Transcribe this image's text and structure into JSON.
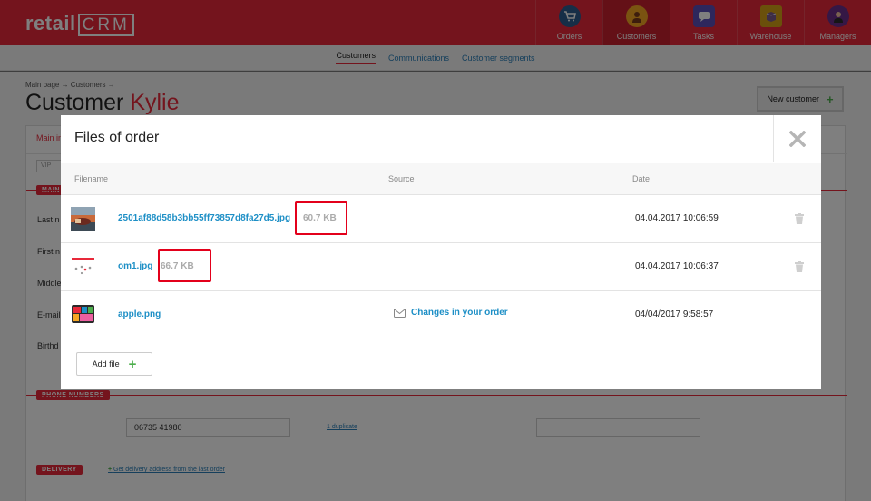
{
  "app": {
    "logo_main": "retail",
    "logo_crm": "CRM"
  },
  "nav": [
    {
      "label": "Orders",
      "icon": "cart-icon",
      "color": "#3a6ea5"
    },
    {
      "label": "Customers",
      "icon": "person-icon",
      "color": "#f5a623"
    },
    {
      "label": "Tasks",
      "icon": "chat-icon",
      "color": "#6a5acd"
    },
    {
      "label": "Warehouse",
      "icon": "box-icon",
      "color": "#d4a017"
    },
    {
      "label": "Managers",
      "icon": "manager-icon",
      "color": "#8e44ad"
    }
  ],
  "subnav": {
    "customers": "Customers",
    "communications": "Communications",
    "segments": "Customer segments"
  },
  "page": {
    "breadcrumb": "Main page → Customers →",
    "title_prefix": "Customer",
    "title_name": "Kylie",
    "new_customer": "New customer",
    "main_tab": "Main in",
    "vip": "VIP",
    "main_section": "MAIN",
    "labels": {
      "last": "Last n",
      "first": "First n",
      "middle": "Middle",
      "email": "E-mail",
      "birthday": "Birthd"
    },
    "phone_section": "PHONE NUMBERS",
    "phone_value": "06735 41980",
    "duplicate_link": "1 duplicate",
    "delivery_section": "DELIVERY",
    "delivery_link": "Get delivery address from the last order"
  },
  "modal": {
    "title": "Files of order",
    "columns": {
      "filename": "Filename",
      "source": "Source",
      "date": "Date"
    },
    "files": [
      {
        "name": "2501af88d58b3bb55ff73857d8fa27d5.jpg",
        "size": "60.7 KB",
        "source": "",
        "date": "04.04.2017 10:06:59",
        "deletable": true
      },
      {
        "name": "om1.jpg",
        "size": "66.7 KB",
        "source": "",
        "date": "04.04.2017 10:06:37",
        "deletable": true
      },
      {
        "name": "apple.png",
        "size": "",
        "source": "Changes in your order",
        "date": "04/04/2017 9:58:57",
        "deletable": false
      }
    ],
    "add_file": "Add file"
  },
  "colors": {
    "brand": "#e8293a",
    "link": "#1d8fc6",
    "highlight": "#e3001b",
    "success": "#4cae4c"
  }
}
